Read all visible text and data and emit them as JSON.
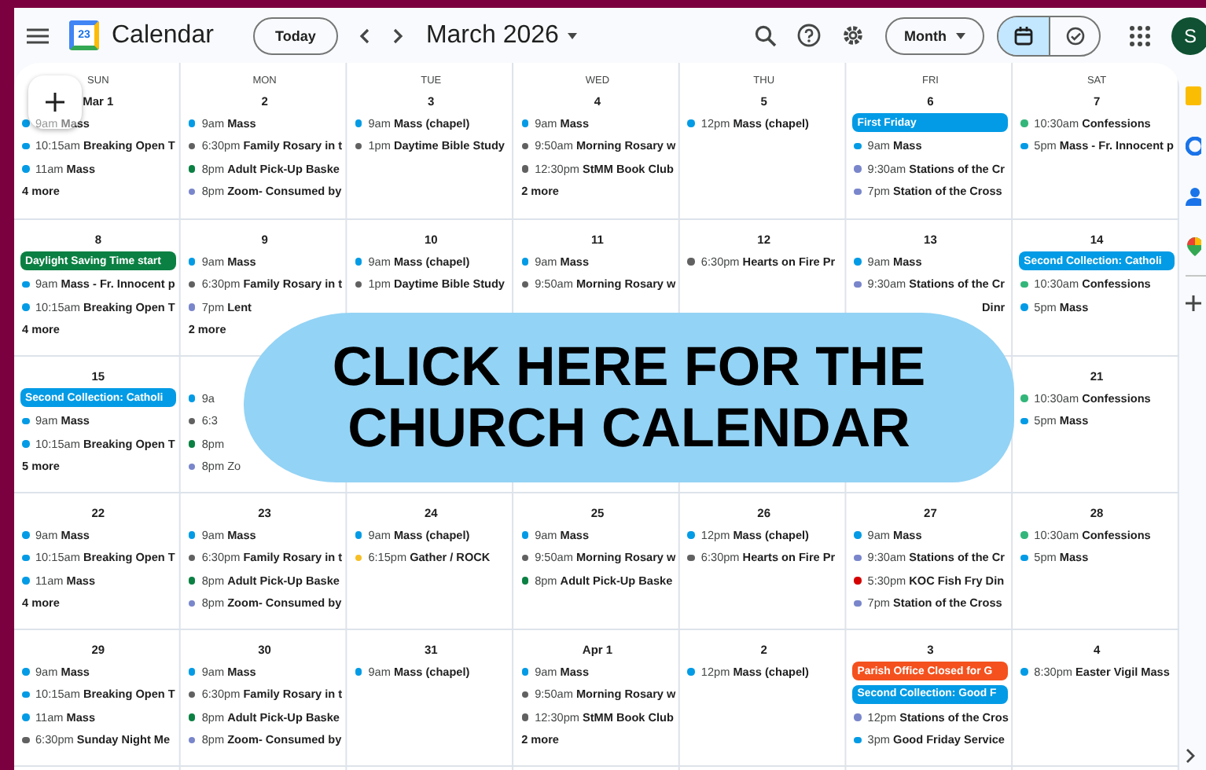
{
  "header": {
    "app_title": "Calendar",
    "logo_text": "23",
    "today_button": "Today",
    "period": "March 2026",
    "view_dropdown": "Month",
    "avatar_initial": "S",
    "view_toggle": [
      {
        "kind": "calendar",
        "selected": true
      },
      {
        "kind": "tasks",
        "selected": false
      }
    ]
  },
  "weekdays": [
    "SUN",
    "MON",
    "TUE",
    "WED",
    "THU",
    "FRI",
    "SAT"
  ],
  "weeks": [
    {
      "days": [
        {
          "date": "Mar 1",
          "items": [
            {
              "kind": "event",
              "color": "#039be5",
              "time": "9am",
              "title": "Mass"
            },
            {
              "kind": "event",
              "color": "#039be5",
              "time": "10:15am",
              "title": "Breaking Open T"
            },
            {
              "kind": "event",
              "color": "#039be5",
              "time": "11am",
              "title": "Mass"
            }
          ],
          "more": "4 more"
        },
        {
          "date": "2",
          "items": [
            {
              "kind": "event",
              "color": "#039be5",
              "time": "9am",
              "title": "Mass"
            },
            {
              "kind": "event",
              "color": "#616161",
              "time": "6:30pm",
              "title": "Family Rosary in t"
            },
            {
              "kind": "event",
              "color": "#0b8043",
              "time": "8pm",
              "title": "Adult Pick-Up Baske"
            },
            {
              "kind": "event",
              "color": "#7986cb",
              "time": "8pm",
              "title": "Zoom- Consumed by"
            }
          ]
        },
        {
          "date": "3",
          "items": [
            {
              "kind": "event",
              "color": "#039be5",
              "time": "9am",
              "title": "Mass (chapel)"
            },
            {
              "kind": "event",
              "color": "#616161",
              "time": "1pm",
              "title": "Daytime Bible Study"
            }
          ]
        },
        {
          "date": "4",
          "items": [
            {
              "kind": "event",
              "color": "#039be5",
              "time": "9am",
              "title": "Mass"
            },
            {
              "kind": "event",
              "color": "#616161",
              "time": "9:50am",
              "title": "Morning Rosary w"
            },
            {
              "kind": "event",
              "color": "#616161",
              "time": "12:30pm",
              "title": "StMM Book Club"
            }
          ],
          "more": "2 more"
        },
        {
          "date": "5",
          "items": [
            {
              "kind": "event",
              "color": "#039be5",
              "time": "12pm",
              "title": "Mass (chapel)"
            }
          ]
        },
        {
          "date": "6",
          "items": [
            {
              "kind": "chip",
              "color": "#039be5",
              "title": "First Friday"
            },
            {
              "kind": "event",
              "color": "#039be5",
              "time": "9am",
              "title": "Mass"
            },
            {
              "kind": "event",
              "color": "#7986cb",
              "time": "9:30am",
              "title": "Stations of the Cr"
            },
            {
              "kind": "event",
              "color": "#7986cb",
              "time": "7pm",
              "title": "Station of the Cross"
            }
          ]
        },
        {
          "date": "7",
          "items": [
            {
              "kind": "event",
              "color": "#33b679",
              "time": "10:30am",
              "title": "Confessions"
            },
            {
              "kind": "event",
              "color": "#039be5",
              "time": "5pm",
              "title": "Mass - Fr. Innocent p"
            }
          ]
        }
      ]
    },
    {
      "days": [
        {
          "date": "8",
          "items": [
            {
              "kind": "chip",
              "color": "#0b8043",
              "title": "Daylight Saving Time start"
            },
            {
              "kind": "event",
              "color": "#039be5",
              "time": "9am",
              "title": "Mass - Fr. Innocent p"
            },
            {
              "kind": "event",
              "color": "#039be5",
              "time": "10:15am",
              "title": "Breaking Open T"
            }
          ],
          "more": "4 more"
        },
        {
          "date": "9",
          "items": [
            {
              "kind": "event",
              "color": "#039be5",
              "time": "9am",
              "title": "Mass"
            },
            {
              "kind": "event",
              "color": "#616161",
              "time": "6:30pm",
              "title": "Family Rosary in t"
            },
            {
              "kind": "event",
              "color": "#7986cb",
              "time": "7pm",
              "title": "Lent"
            }
          ],
          "more": "2 more"
        },
        {
          "date": "10",
          "items": [
            {
              "kind": "event",
              "color": "#039be5",
              "time": "9am",
              "title": "Mass (chapel)"
            },
            {
              "kind": "event",
              "color": "#616161",
              "time": "1pm",
              "title": "Daytime Bible Study"
            }
          ]
        },
        {
          "date": "11",
          "items": [
            {
              "kind": "event",
              "color": "#039be5",
              "time": "9am",
              "title": "Mass"
            },
            {
              "kind": "event",
              "color": "#616161",
              "time": "9:50am",
              "title": "Morning Rosary w"
            }
          ]
        },
        {
          "date": "12",
          "items": [
            {
              "kind": "event",
              "color": "#616161",
              "time": "6:30pm",
              "title": "Hearts on Fire Pr"
            }
          ]
        },
        {
          "date": "13",
          "items": [
            {
              "kind": "event",
              "color": "#039be5",
              "time": "9am",
              "title": "Mass"
            },
            {
              "kind": "event",
              "color": "#7986cb",
              "time": "9:30am",
              "title": "Stations of the Cr"
            },
            {
              "kind": "tail",
              "text": "Dinr"
            }
          ]
        },
        {
          "date": "14",
          "items": [
            {
              "kind": "chip",
              "color": "#039be5",
              "title": "Second Collection: Catholi"
            },
            {
              "kind": "event",
              "color": "#33b679",
              "time": "10:30am",
              "title": "Confessions"
            },
            {
              "kind": "event",
              "color": "#039be5",
              "time": "5pm",
              "title": "Mass"
            }
          ]
        }
      ]
    },
    {
      "days": [
        {
          "date": "15",
          "items": [
            {
              "kind": "chip",
              "color": "#039be5",
              "title": "Second Collection: Catholi"
            },
            {
              "kind": "event",
              "color": "#039be5",
              "time": "9am",
              "title": "Mass"
            },
            {
              "kind": "event",
              "color": "#039be5",
              "time": "10:15am",
              "title": "Breaking Open T"
            }
          ],
          "more": "5 more"
        },
        {
          "items": [
            {
              "kind": "fragment",
              "color": "#039be5",
              "text": "9a"
            },
            {
              "kind": "fragment",
              "color": "#616161",
              "text": "6:3"
            },
            {
              "kind": "fragment",
              "color": "#0b8043",
              "text": "8pm"
            },
            {
              "kind": "fragment",
              "color": "#7986cb",
              "text": "8pm Zo"
            }
          ]
        },
        {
          "date": "21",
          "items": [
            {
              "kind": "event",
              "color": "#33b679",
              "time": "10:30am",
              "title": "Confessions"
            },
            {
              "kind": "event",
              "color": "#039be5",
              "time": "5pm",
              "title": "Mass"
            }
          ]
        }
      ]
    },
    {
      "days": [
        {
          "date": "22",
          "items": [
            {
              "kind": "event",
              "color": "#039be5",
              "time": "9am",
              "title": "Mass"
            },
            {
              "kind": "event",
              "color": "#039be5",
              "time": "10:15am",
              "title": "Breaking Open T"
            },
            {
              "kind": "event",
              "color": "#039be5",
              "time": "11am",
              "title": "Mass"
            }
          ],
          "more": "4 more"
        },
        {
          "date": "23",
          "items": [
            {
              "kind": "event",
              "color": "#039be5",
              "time": "9am",
              "title": "Mass"
            },
            {
              "kind": "event",
              "color": "#616161",
              "time": "6:30pm",
              "title": "Family Rosary in t"
            },
            {
              "kind": "event",
              "color": "#0b8043",
              "time": "8pm",
              "title": "Adult Pick-Up Baske"
            },
            {
              "kind": "event",
              "color": "#7986cb",
              "time": "8pm",
              "title": "Zoom- Consumed by"
            }
          ]
        },
        {
          "date": "24",
          "items": [
            {
              "kind": "event",
              "color": "#039be5",
              "time": "9am",
              "title": "Mass (chapel)"
            },
            {
              "kind": "event",
              "color": "#f6bf26",
              "time": "6:15pm",
              "title": "Gather / ROCK"
            }
          ]
        },
        {
          "date": "25",
          "items": [
            {
              "kind": "event",
              "color": "#039be5",
              "time": "9am",
              "title": "Mass"
            },
            {
              "kind": "event",
              "color": "#616161",
              "time": "9:50am",
              "title": "Morning Rosary w"
            },
            {
              "kind": "event",
              "color": "#0b8043",
              "time": "8pm",
              "title": "Adult Pick-Up Baske"
            }
          ]
        },
        {
          "date": "26",
          "items": [
            {
              "kind": "event",
              "color": "#039be5",
              "time": "12pm",
              "title": "Mass (chapel)"
            },
            {
              "kind": "event",
              "color": "#616161",
              "time": "6:30pm",
              "title": "Hearts on Fire Pr"
            }
          ]
        },
        {
          "date": "27",
          "items": [
            {
              "kind": "event",
              "color": "#039be5",
              "time": "9am",
              "title": "Mass"
            },
            {
              "kind": "event",
              "color": "#7986cb",
              "time": "9:30am",
              "title": "Stations of the Cr"
            },
            {
              "kind": "event",
              "color": "#d50000",
              "time": "5:30pm",
              "title": "KOC Fish Fry Din"
            },
            {
              "kind": "event",
              "color": "#7986cb",
              "time": "7pm",
              "title": "Station of the Cross"
            }
          ]
        },
        {
          "date": "28",
          "items": [
            {
              "kind": "event",
              "color": "#33b679",
              "time": "10:30am",
              "title": "Confessions"
            },
            {
              "kind": "event",
              "color": "#039be5",
              "time": "5pm",
              "title": "Mass"
            }
          ]
        }
      ]
    },
    {
      "days": [
        {
          "date": "29",
          "items": [
            {
              "kind": "event",
              "color": "#039be5",
              "time": "9am",
              "title": "Mass"
            },
            {
              "kind": "event",
              "color": "#039be5",
              "time": "10:15am",
              "title": "Breaking Open T"
            },
            {
              "kind": "event",
              "color": "#039be5",
              "time": "11am",
              "title": "Mass"
            },
            {
              "kind": "event",
              "color": "#616161",
              "time": "6:30pm",
              "title": "Sunday Night Me"
            }
          ]
        },
        {
          "date": "30",
          "items": [
            {
              "kind": "event",
              "color": "#039be5",
              "time": "9am",
              "title": "Mass"
            },
            {
              "kind": "event",
              "color": "#616161",
              "time": "6:30pm",
              "title": "Family Rosary in t"
            },
            {
              "kind": "event",
              "color": "#0b8043",
              "time": "8pm",
              "title": "Adult Pick-Up Baske"
            },
            {
              "kind": "event",
              "color": "#7986cb",
              "time": "8pm",
              "title": "Zoom- Consumed by"
            }
          ]
        },
        {
          "date": "31",
          "items": [
            {
              "kind": "event",
              "color": "#039be5",
              "time": "9am",
              "title": "Mass (chapel)"
            }
          ]
        },
        {
          "date": "Apr 1",
          "items": [
            {
              "kind": "event",
              "color": "#039be5",
              "time": "9am",
              "title": "Mass"
            },
            {
              "kind": "event",
              "color": "#616161",
              "time": "9:50am",
              "title": "Morning Rosary w"
            },
            {
              "kind": "event",
              "color": "#616161",
              "time": "12:30pm",
              "title": "StMM Book Club"
            }
          ],
          "more": "2 more"
        },
        {
          "date": "2",
          "items": [
            {
              "kind": "event",
              "color": "#039be5",
              "time": "12pm",
              "title": "Mass (chapel)"
            }
          ]
        },
        {
          "date": "3",
          "items": [
            {
              "kind": "chip",
              "color": "#f4511e",
              "title": "Parish Office Closed for G"
            },
            {
              "kind": "chip",
              "color": "#039be5",
              "title": "Second Collection: Good F"
            },
            {
              "kind": "event",
              "color": "#7986cb",
              "time": "12pm",
              "title": "Stations of the Cros"
            },
            {
              "kind": "event",
              "color": "#039be5",
              "time": "3pm",
              "title": "Good Friday Service"
            }
          ]
        },
        {
          "date": "4",
          "items": [
            {
              "kind": "event",
              "color": "#039be5",
              "time": "8:30pm",
              "title": "Easter Vigil Mass"
            }
          ]
        }
      ]
    }
  ],
  "banner": {
    "lines": [
      "CLICK HERE FOR THE",
      "CHURCH CALENDAR"
    ]
  }
}
